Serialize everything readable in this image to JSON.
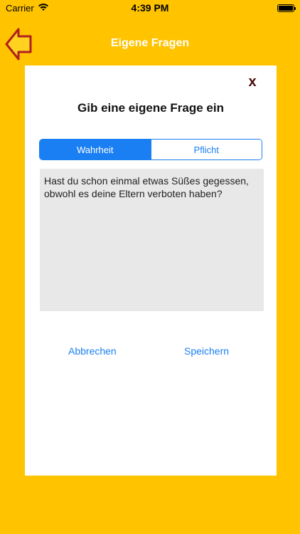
{
  "status_bar": {
    "carrier": "Carrier",
    "time": "4:39 PM",
    "icons": [
      "wifi-icon",
      "battery-icon"
    ]
  },
  "nav": {
    "title": "Eigene Fragen",
    "back_icon": "arrow-left-icon"
  },
  "dialog": {
    "close_label": "x",
    "title": "Gib eine eigene Frage ein",
    "segments": [
      {
        "label": "Wahrheit",
        "selected": true
      },
      {
        "label": "Pflicht",
        "selected": false
      }
    ],
    "question_text": "Hast du schon einmal etwas Süßes gegessen, obwohl es deine Eltern verboten haben?",
    "cancel_label": "Abbrechen",
    "save_label": "Speichern"
  },
  "colors": {
    "background": "#FFC300",
    "accent_blue": "#1A7FF2",
    "back_arrow_fill": "#FFD21F",
    "back_arrow_stroke": "#B02020",
    "close_color": "#4A0B0B",
    "text_area": "#E8E8E8"
  }
}
